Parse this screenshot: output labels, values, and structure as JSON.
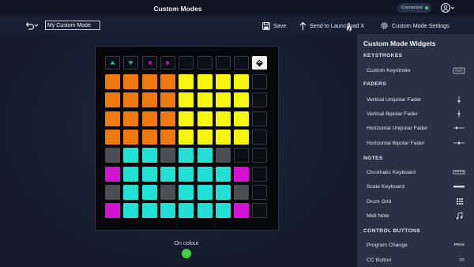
{
  "app": {
    "title": "Custom Modes"
  },
  "status": {
    "connection": "Connected",
    "connection_color": "#46d065"
  },
  "toolbar": {
    "mode_name": "My Custom Mode",
    "save_label": "Save",
    "send_label": "Send to Launchpad X",
    "settings_label": "Custom Mode Settings"
  },
  "grid": {
    "colors": {
      "orange": "#f0790f",
      "yellow": "#f5f50f",
      "cyan": "#22e0d3",
      "magenta": "#d214d2",
      "grey": "#4a4d52",
      "empty": "#0b0e13"
    },
    "top_buttons": [
      {
        "icon": "up-arrow-icon",
        "color": "#1fc7a8"
      },
      {
        "icon": "down-arrow-icon",
        "color": "#1fc7a8"
      },
      {
        "icon": "left-arrow-icon",
        "color": "#c81bd0"
      },
      {
        "icon": "right-arrow-icon",
        "color": "#c81bd0"
      },
      {
        "icon": "blank",
        "color": ""
      },
      {
        "icon": "blank",
        "color": ""
      },
      {
        "icon": "blank",
        "color": ""
      },
      {
        "icon": "blank",
        "color": ""
      }
    ],
    "logo_button": "novation-logo-icon",
    "rows": [
      [
        "orange",
        "orange",
        "orange",
        "orange",
        "yellow",
        "yellow",
        "yellow",
        "yellow"
      ],
      [
        "orange",
        "orange",
        "orange",
        "orange",
        "yellow",
        "yellow",
        "yellow",
        "yellow"
      ],
      [
        "orange",
        "orange",
        "orange",
        "orange",
        "yellow",
        "yellow",
        "yellow",
        "yellow"
      ],
      [
        "orange",
        "orange",
        "orange",
        "orange",
        "yellow",
        "yellow",
        "yellow",
        "yellow"
      ],
      [
        "grey",
        "cyan",
        "cyan",
        "grey",
        "cyan",
        "cyan",
        "grey",
        "empty"
      ],
      [
        "magenta",
        "cyan",
        "cyan",
        "cyan",
        "cyan",
        "cyan",
        "cyan",
        "magenta"
      ],
      [
        "grey",
        "cyan",
        "cyan",
        "grey",
        "cyan",
        "cyan",
        "cyan",
        "grey"
      ],
      [
        "magenta",
        "cyan",
        "cyan",
        "cyan",
        "cyan",
        "cyan",
        "cyan",
        "magenta"
      ]
    ]
  },
  "on_colour": {
    "label": "On colour",
    "color": "#3ed43c"
  },
  "panel": {
    "title": "Custom Mode Widgets",
    "sections": [
      {
        "heading": "KEYSTROKES",
        "items": [
          {
            "label": "Custom Keystroke",
            "icon": "keyboard-icon"
          }
        ]
      },
      {
        "heading": "FADERS",
        "items": [
          {
            "label": "Vertical Unipolar Fader",
            "icon": "vertical-unipolar-fader-icon"
          },
          {
            "label": "Vertical Bipolar Fader",
            "icon": "vertical-bipolar-fader-icon"
          },
          {
            "label": "Horizontal Unipolar Fader",
            "icon": "horizontal-unipolar-fader-icon"
          },
          {
            "label": "Horizontal Bipolar Fader",
            "icon": "horizontal-bipolar-fader-icon"
          }
        ]
      },
      {
        "heading": "NOTES",
        "items": [
          {
            "label": "Chromatic Keyboard",
            "icon": "chromatic-keyboard-icon"
          },
          {
            "label": "Scale Keyboard",
            "icon": "scale-keyboard-icon"
          },
          {
            "label": "Drum Grid",
            "icon": "drum-grid-icon"
          },
          {
            "label": "Midi Note",
            "icon": "music-note-icon"
          }
        ]
      },
      {
        "heading": "CONTROL BUTTONS",
        "items": [
          {
            "label": "Program Change",
            "icon": "prog-icon",
            "tag": "PROG"
          },
          {
            "label": "CC Button",
            "icon": "cc-icon",
            "tag": "CC"
          }
        ]
      }
    ]
  }
}
